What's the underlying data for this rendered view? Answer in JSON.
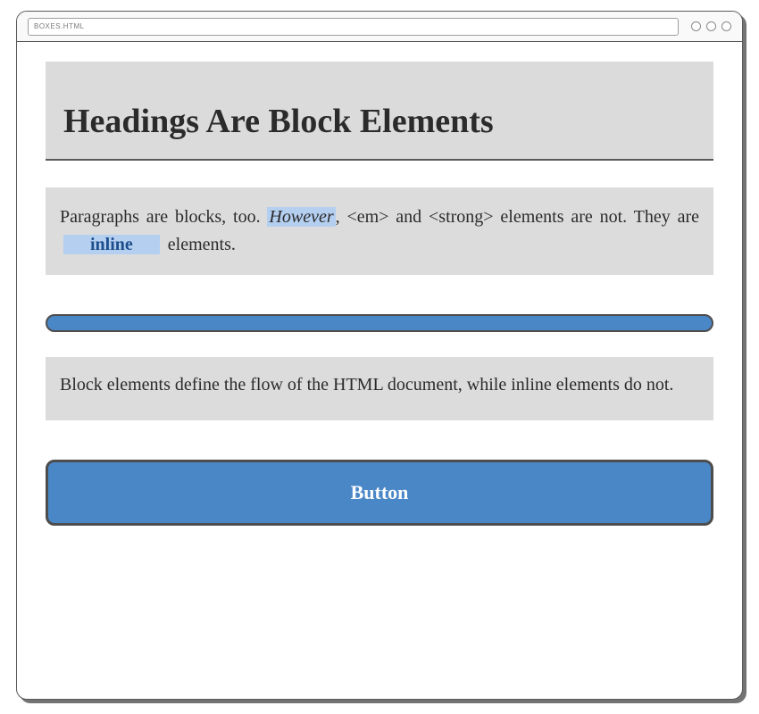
{
  "browser": {
    "address": "BOXES.HTML"
  },
  "heading": "Headings Are Block Elements",
  "paragraph1": {
    "part1": "Paragraphs are blocks, too. ",
    "em": "However",
    "part2": ", <em> and <strong> elements are not. They are ",
    "strong": "inline",
    "part3": " elements."
  },
  "paragraph2": "Block elements define the flow of the HTML document, while inline elements do not.",
  "button_label": "Button"
}
